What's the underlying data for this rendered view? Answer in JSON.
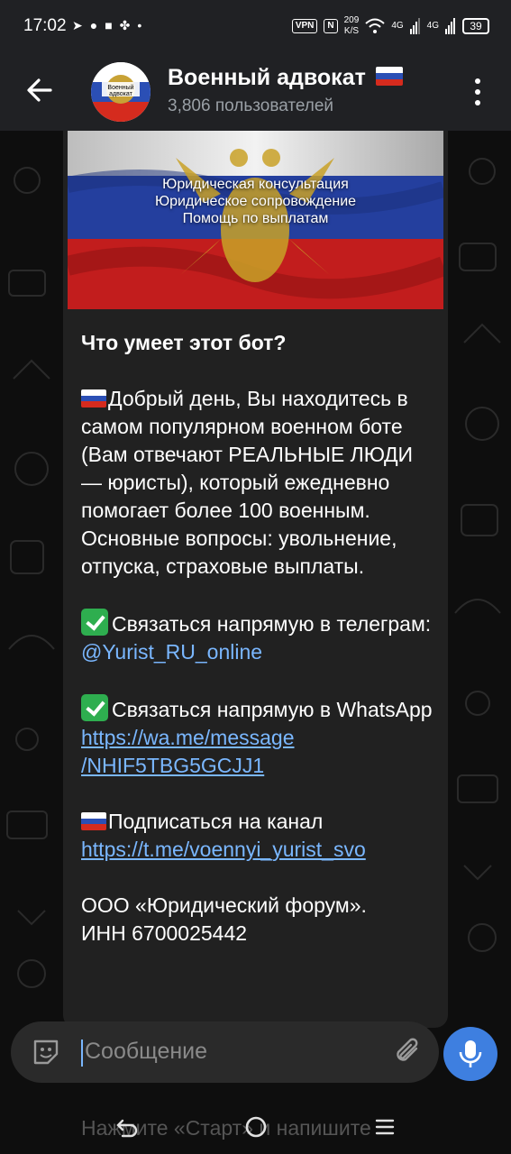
{
  "status_bar": {
    "time": "17:02",
    "vpn": "VPN",
    "nfc": "N",
    "net_speed_value": "209",
    "net_speed_unit": "K/S",
    "signal_1": "4G",
    "signal_2": "4G",
    "battery": "39",
    "left_icons": [
      "telegram-icon",
      "chat-icon",
      "app-icon",
      "clover-icon",
      "dot-icon"
    ]
  },
  "header": {
    "title": "Военный адвокат",
    "subtitle": "3,806 пользователей",
    "avatar_text_line1": "Военный",
    "avatar_text_line2": "адвокат"
  },
  "message": {
    "banner_lines": [
      "Юридическая консультация",
      "Юридическое сопровождение",
      "Помощь по выплатам"
    ],
    "title": "Что умеет этот бот?",
    "intro": "Добрый день, Вы находитесь в самом популярном военном боте (Вам отвечают РЕАЛЬНЫЕ ЛЮДИ — юристы), который ежедневно помогает более 100 военным. Основные вопросы: увольнение, отпуска, страховые выплаты.",
    "telegram_text": "Связаться напрямую в телеграм: ",
    "telegram_handle": "@Yurist_RU_online",
    "whatsapp_text": "Связаться напрямую в WhatsApp",
    "whatsapp_link_1": "https://wa.me/message",
    "whatsapp_link_2": "/NHIF5TBG5GCJJ1",
    "channel_text": "Подписаться на канал",
    "channel_link": "https://t.me/voennyi_yurist_svo",
    "company": "ООО «Юридический форум».",
    "inn": "ИНН 6700025442"
  },
  "input": {
    "placeholder": "Сообщение"
  },
  "bottom_hint": "Нажмите «Старт» и напишите",
  "colors": {
    "accent": "#3e7fe0",
    "link": "#7ab7ff",
    "check": "#2eae4f",
    "bubble": "#212121",
    "header": "#202124"
  }
}
